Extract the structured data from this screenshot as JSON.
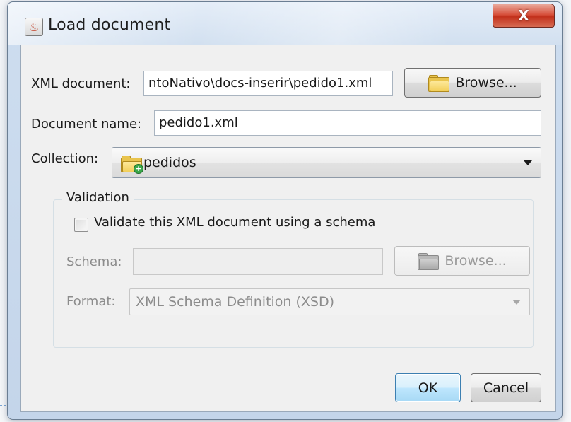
{
  "window": {
    "title": "Load document",
    "close_label": "X"
  },
  "form": {
    "xml_document_label": "XML document:",
    "xml_document_value": "ntoNativo\\docs-inserir\\pedido1.xml",
    "browse_label": "Browse...",
    "document_name_label": "Document name:",
    "document_name_value": "pedido1.xml",
    "collection_label": "Collection:",
    "collection_value": "pedidos"
  },
  "validation": {
    "group_title": "Validation",
    "checkbox_label": "Validate this XML document using a schema",
    "checkbox_checked": false,
    "schema_label": "Schema:",
    "schema_value": "",
    "schema_browse_label": "Browse...",
    "format_label": "Format:",
    "format_value": "XML Schema Definition (XSD)"
  },
  "buttons": {
    "ok": "OK",
    "cancel": "Cancel"
  },
  "colors": {
    "close_button": "#c2301b",
    "ok_button_border": "#3c7fb1",
    "folder": "#e9c44d"
  },
  "icons": {
    "app": "java-cup-icon",
    "browse": "folder-icon",
    "collection": "folder-add-icon",
    "schema_browse": "folder-disabled-icon"
  }
}
